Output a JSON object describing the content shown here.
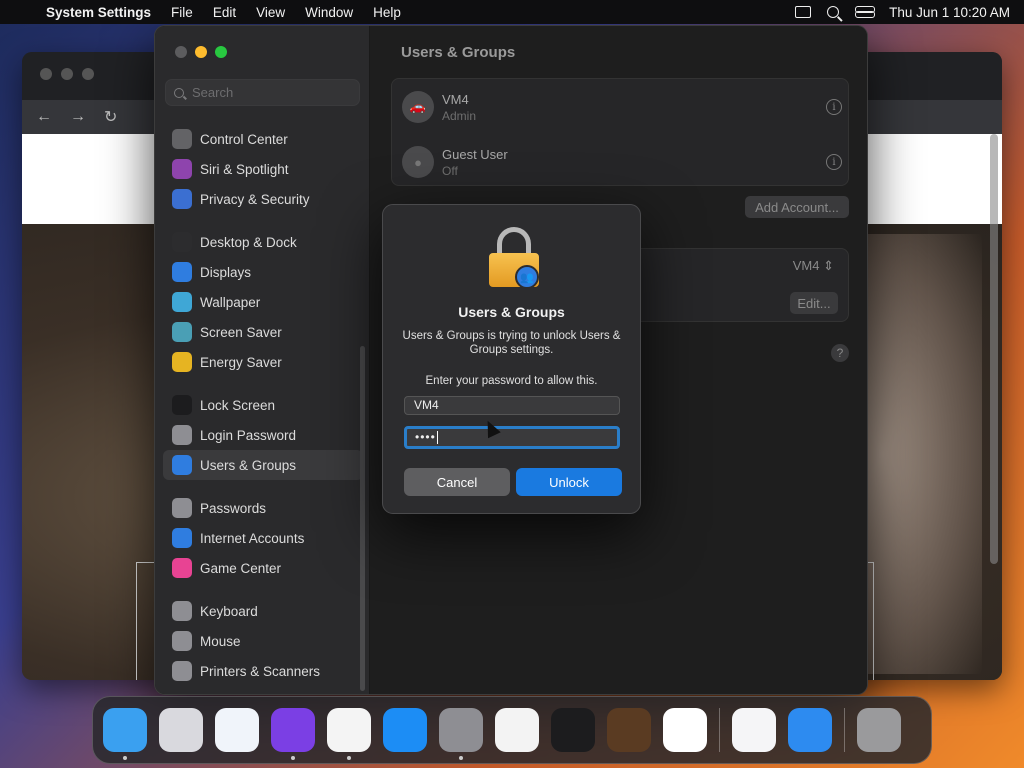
{
  "menubar": {
    "app_name": "System Settings",
    "items": [
      "File",
      "Edit",
      "View",
      "Window",
      "Help"
    ],
    "clock": "Thu Jun 1  10:20 AM"
  },
  "sidebar": {
    "search_placeholder": "Search",
    "items": [
      {
        "label": "Control Center",
        "icon": "control-center-icon",
        "color": "#636366"
      },
      {
        "label": "Siri & Spotlight",
        "icon": "siri-icon",
        "color": "#8e44ad"
      },
      {
        "label": "Privacy & Security",
        "icon": "hand-icon",
        "color": "#3b6fd1"
      },
      {
        "label": "Desktop & Dock",
        "icon": "dock-icon",
        "color": "#2c2c2e"
      },
      {
        "label": "Displays",
        "icon": "displays-icon",
        "color": "#2f7de0"
      },
      {
        "label": "Wallpaper",
        "icon": "wallpaper-icon",
        "color": "#3fa7d6"
      },
      {
        "label": "Screen Saver",
        "icon": "screen-saver-icon",
        "color": "#4a9fb5"
      },
      {
        "label": "Energy Saver",
        "icon": "energy-icon",
        "color": "#e6b422"
      },
      {
        "label": "Lock Screen",
        "icon": "lock-screen-icon",
        "color": "#1c1c1e"
      },
      {
        "label": "Login Password",
        "icon": "login-password-icon",
        "color": "#8e8e93"
      },
      {
        "label": "Users & Groups",
        "icon": "users-icon",
        "color": "#2f7de0"
      },
      {
        "label": "Passwords",
        "icon": "key-icon",
        "color": "#8e8e93"
      },
      {
        "label": "Internet Accounts",
        "icon": "at-icon",
        "color": "#2f7de0"
      },
      {
        "label": "Game Center",
        "icon": "game-center-icon",
        "color": "#e84393"
      },
      {
        "label": "Keyboard",
        "icon": "keyboard-icon",
        "color": "#8e8e93"
      },
      {
        "label": "Mouse",
        "icon": "mouse-icon",
        "color": "#8e8e93"
      },
      {
        "label": "Printers & Scanners",
        "icon": "printer-icon",
        "color": "#8e8e93"
      }
    ]
  },
  "main": {
    "title": "Users & Groups",
    "users": [
      {
        "name": "VM4",
        "role": "Admin"
      },
      {
        "name": "Guest User",
        "role": "Off"
      }
    ],
    "add_account_label": "Add Account...",
    "auto_login_value": "VM4",
    "edit_label": "Edit..."
  },
  "dialog": {
    "title": "Users & Groups",
    "message": "Users & Groups is trying to unlock Users & Groups settings.",
    "prompt": "Enter your password to allow this.",
    "username": "VM4",
    "password_mask": "••••",
    "cancel_label": "Cancel",
    "unlock_label": "Unlock"
  },
  "dock": {
    "apps": [
      {
        "name": "Finder",
        "icon": "finder-icon",
        "color": "#3aa0f0",
        "running": true
      },
      {
        "name": "Launchpad",
        "icon": "launchpad-icon",
        "color": "#d9d9de",
        "running": false
      },
      {
        "name": "Safari",
        "icon": "safari-icon",
        "color": "#f0f4fa",
        "running": false
      },
      {
        "name": "Firefox",
        "icon": "firefox-icon",
        "color": "#7b3fe4",
        "running": true
      },
      {
        "name": "Chrome",
        "icon": "chrome-icon",
        "color": "#f4f4f4",
        "running": true
      },
      {
        "name": "App Store",
        "icon": "app-store-icon",
        "color": "#1c8df5",
        "running": false
      },
      {
        "name": "System Settings",
        "icon": "system-settings-icon",
        "color": "#8e8e93",
        "running": true
      },
      {
        "name": "TextEdit",
        "icon": "textedit-icon",
        "color": "#f3f3f3",
        "running": false
      },
      {
        "name": "Terminal",
        "icon": "terminal-icon",
        "color": "#1c1c1e",
        "running": false
      },
      {
        "name": "GarageBand",
        "icon": "garageband-icon",
        "color": "#5a3b22",
        "running": false
      },
      {
        "name": "Visual Studio Code",
        "icon": "vscode-icon",
        "color": "#ffffff",
        "running": false
      },
      {
        "name": "Visual Studio",
        "icon": "visual-studio-icon",
        "color": "#f5f5f7",
        "running": false
      },
      {
        "name": "Keynote",
        "icon": "keynote-icon",
        "color": "#2d8bf0",
        "running": false
      },
      {
        "name": "Trash",
        "icon": "trash-icon",
        "color": "#9a9a9c",
        "running": false
      }
    ]
  }
}
